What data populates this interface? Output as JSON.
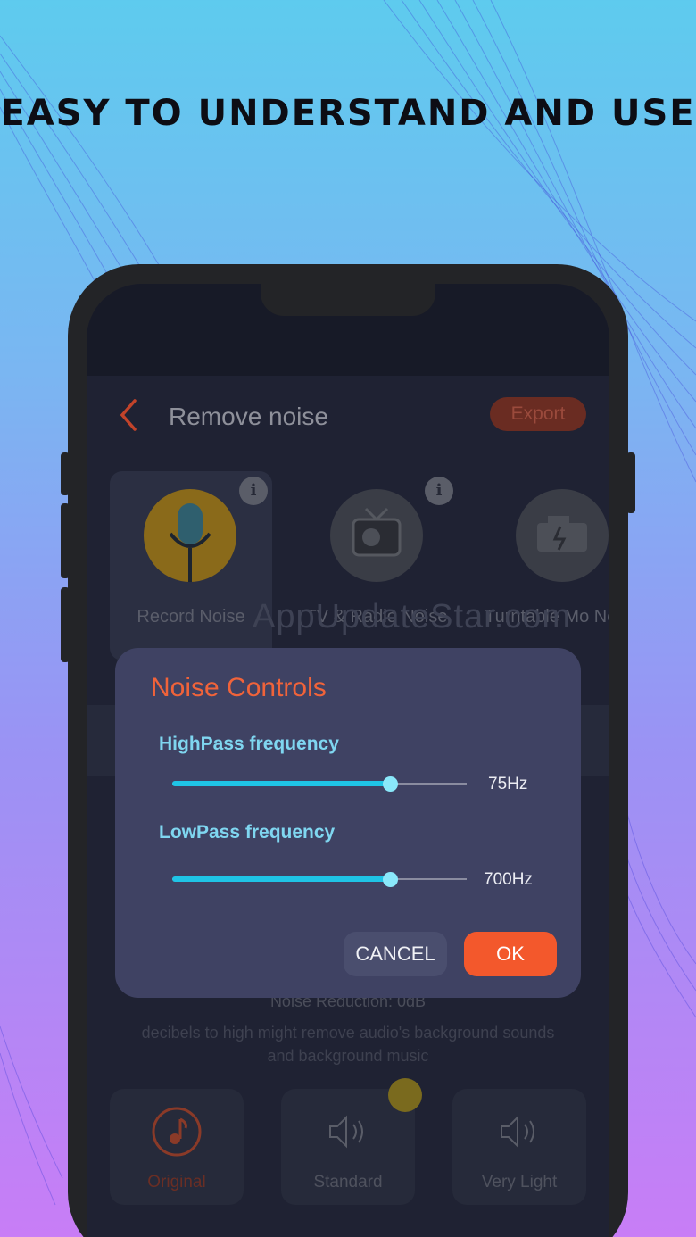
{
  "headline": "EASY TO UNDERSTAND AND USE",
  "screen": {
    "title": "Remove noise",
    "export_label": "Export",
    "watermark": "AppUpdateStar.com",
    "modes": [
      {
        "label": "Record Noise",
        "icon": "microphone-icon"
      },
      {
        "label": "TV & Radio Noise",
        "icon": "tv-icon"
      },
      {
        "label": "Turntable Mo Noise",
        "icon": "engine-icon"
      }
    ],
    "reduction_text": "Noise Reduction:   0dB",
    "hint_text": "decibels to high might remove audio's background sounds and background music",
    "presets": [
      {
        "label": "Original",
        "icon": "music-note-icon"
      },
      {
        "label": "Standard",
        "icon": "speaker-wave-icon"
      },
      {
        "label": "Very Light",
        "icon": "speaker-wave-icon"
      }
    ]
  },
  "dialog": {
    "title": "Noise Controls",
    "highpass": {
      "label": "HighPass frequency",
      "value_text": "75Hz",
      "level": 0.74
    },
    "lowpass": {
      "label": "LowPass frequency",
      "value_text": "700Hz",
      "level": 0.74
    },
    "cancel_label": "CANCEL",
    "ok_label": "OK"
  },
  "colors": {
    "accent": "#f3582c",
    "slider": "#1fc4e6",
    "dialog_bg": "#3f4263",
    "screen_bg": "#1f2233"
  }
}
